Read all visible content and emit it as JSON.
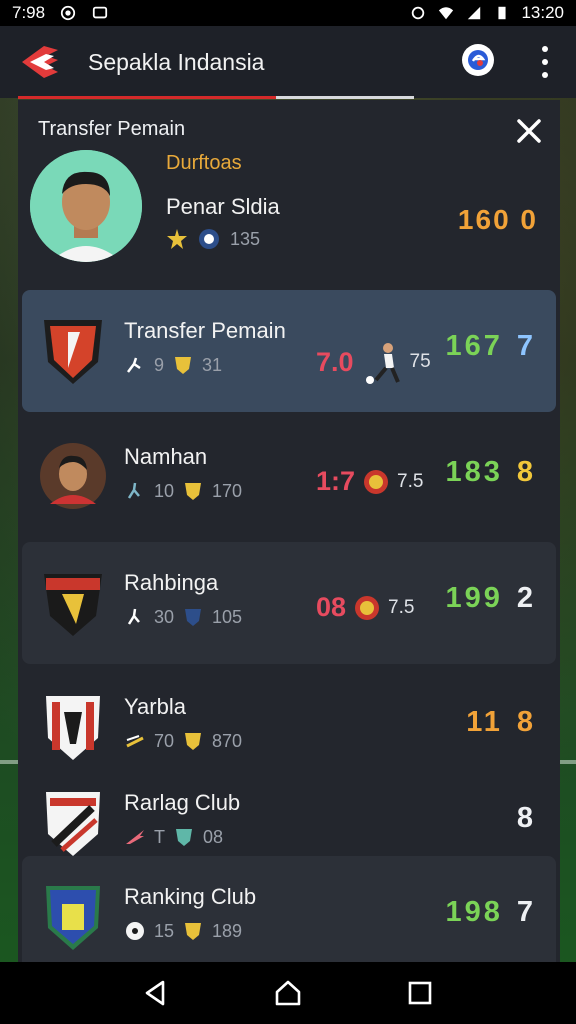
{
  "status_bar": {
    "time_left": "7:98",
    "time_right": "13:20"
  },
  "app_bar": {
    "title": "Sepakla Indansia"
  },
  "panel": {
    "header": "Transfer Pemain",
    "hero": {
      "subtitle": "Durftoas",
      "name": "Penar Sldia",
      "meta_value": "135",
      "score": "160 0"
    }
  },
  "rows": [
    {
      "name": "Transfer Pemain",
      "meta_a": "9",
      "meta_b": "31",
      "mid_value": "7.0",
      "mid_small": "75",
      "score": "167",
      "score_tail": "7",
      "score_color": "#7bd357",
      "tail_color": "#8ec5ff"
    },
    {
      "name": "Namhan",
      "meta_a": "10",
      "meta_b": "170",
      "mid_value": "1:7",
      "mid_small": "7.5",
      "score": "183",
      "score_tail": "8",
      "score_color": "#7bd357",
      "tail_color": "#f1c73a"
    },
    {
      "name": "Rahbinga",
      "meta_a": "30",
      "meta_b": "105",
      "mid_value": "08",
      "mid_small": "7.5",
      "score": "199",
      "score_tail": "2",
      "score_color": "#7bd357",
      "tail_color": "#eef0f3"
    },
    {
      "name": "Yarbla",
      "meta_a": "70",
      "meta_b": "870",
      "mid_value": "",
      "mid_small": "",
      "score": "11",
      "score_tail": "8",
      "score_color": "#f1a238",
      "tail_color": "#f1a238"
    },
    {
      "name": "Rarlag Club",
      "meta_a": "T",
      "meta_b": "08",
      "mid_value": "",
      "mid_small": "",
      "score": "",
      "score_tail": "8",
      "score_color": "#eef0f3",
      "tail_color": "#eef0f3"
    },
    {
      "name": "Ranking Club",
      "meta_a": "15",
      "meta_b": "189",
      "mid_value": "",
      "mid_small": "",
      "score": "198",
      "score_tail": "7",
      "score_color": "#7bd357",
      "tail_color": "#eef0f3"
    }
  ],
  "icons": {
    "close": "close-icon",
    "menu": "more-vert-icon",
    "back": "back-icon",
    "home": "home-icon",
    "recents": "recents-icon"
  },
  "colors": {
    "accent": "#d42a2a",
    "score_green": "#7bd357",
    "score_orange": "#f1a238",
    "mid_red": "#e74b5f"
  }
}
